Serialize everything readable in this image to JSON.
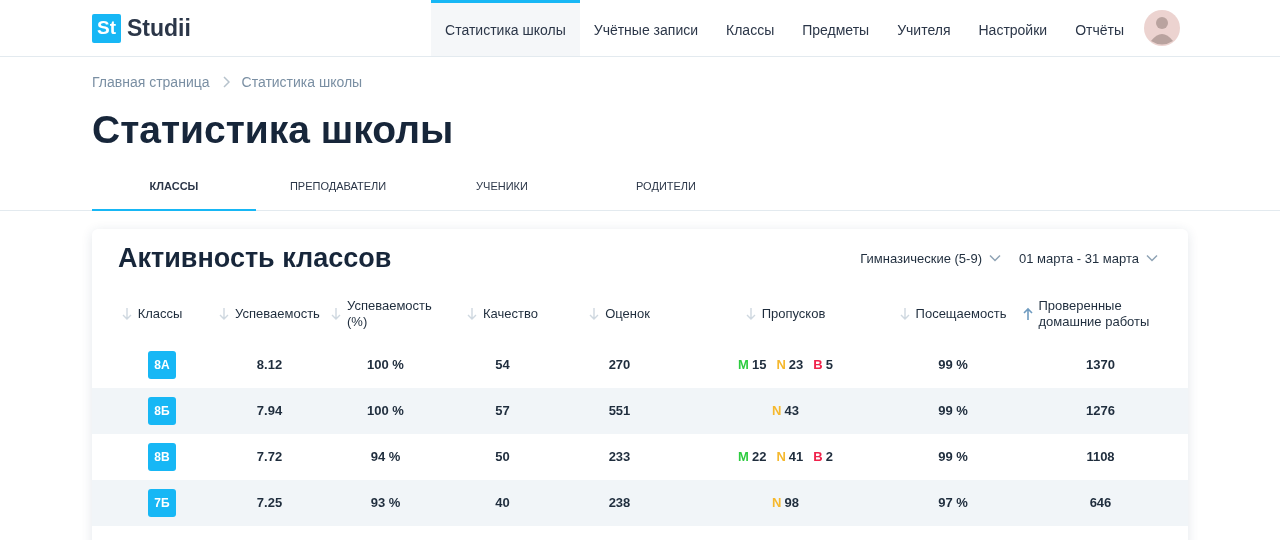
{
  "logo": {
    "mark": "St",
    "name": "Studii"
  },
  "nav": [
    {
      "label": "Статистика школы",
      "selected": true
    },
    {
      "label": "Учётные записи",
      "selected": false
    },
    {
      "label": "Классы",
      "selected": false
    },
    {
      "label": "Предметы",
      "selected": false
    },
    {
      "label": "Учителя",
      "selected": false
    },
    {
      "label": "Настройки",
      "selected": false
    },
    {
      "label": "Отчёты",
      "selected": false
    }
  ],
  "breadcrumbs": [
    "Главная страница",
    "Статистика школы"
  ],
  "title": "Статистика школы",
  "tabs": [
    {
      "label": "КЛАССЫ",
      "selected": true
    },
    {
      "label": "ПРЕПОДАВАТЕЛИ",
      "selected": false
    },
    {
      "label": "УЧЕНИКИ",
      "selected": false
    },
    {
      "label": "РОДИТЕЛИ",
      "selected": false
    }
  ],
  "card": {
    "title": "Активность классов",
    "filters": [
      "Гимназические (5-9)",
      "01 марта - 31 марта"
    ]
  },
  "table": {
    "columns": [
      {
        "label": "Классы",
        "sorted": false
      },
      {
        "label": "Успеваемость",
        "sorted": false
      },
      {
        "label": "Успеваемость (%)",
        "sorted": false
      },
      {
        "label": "Качество",
        "sorted": false
      },
      {
        "label": "Оценок",
        "sorted": false
      },
      {
        "label": "Пропусков",
        "sorted": false
      },
      {
        "label": "Посещаемость",
        "sorted": false
      },
      {
        "label": "Проверенные домашние работы",
        "sorted": true
      }
    ],
    "rows": [
      {
        "class": "8А",
        "grade": "8.12",
        "percent": "100 %",
        "quality": "54",
        "marks": "270",
        "absences": [
          {
            "letter": "M",
            "count": "15",
            "color": "#2ecc40"
          },
          {
            "letter": "N",
            "count": "23",
            "color": "#f5b82e"
          },
          {
            "letter": "B",
            "count": "5",
            "color": "#f0224b"
          }
        ],
        "attendance": "99 %",
        "homework": "1370"
      },
      {
        "class": "8Б",
        "grade": "7.94",
        "percent": "100 %",
        "quality": "57",
        "marks": "551",
        "absences": [
          {
            "letter": "N",
            "count": "43",
            "color": "#f5b82e"
          }
        ],
        "attendance": "99 %",
        "homework": "1276"
      },
      {
        "class": "8В",
        "grade": "7.72",
        "percent": "94 %",
        "quality": "50",
        "marks": "233",
        "absences": [
          {
            "letter": "M",
            "count": "22",
            "color": "#2ecc40"
          },
          {
            "letter": "N",
            "count": "41",
            "color": "#f5b82e"
          },
          {
            "letter": "B",
            "count": "2",
            "color": "#f0224b"
          }
        ],
        "attendance": "99 %",
        "homework": "1108"
      },
      {
        "class": "7Б",
        "grade": "7.25",
        "percent": "93 %",
        "quality": "40",
        "marks": "238",
        "absences": [
          {
            "letter": "N",
            "count": "98",
            "color": "#f5b82e"
          }
        ],
        "attendance": "97 %",
        "homework": "646"
      }
    ]
  }
}
